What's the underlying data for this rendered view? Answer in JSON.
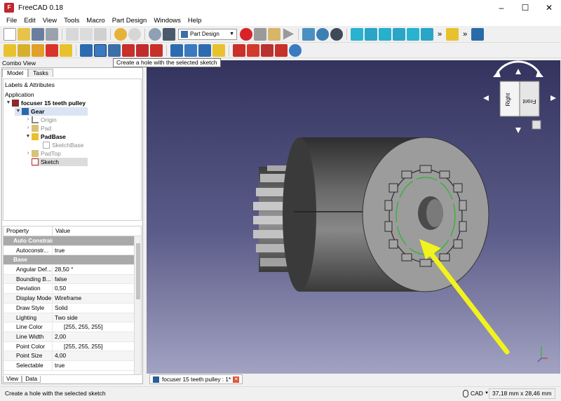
{
  "window": {
    "title": "FreeCAD 0.18",
    "minimize": "–",
    "maximize": "☐",
    "close": "✕"
  },
  "menu": [
    "File",
    "Edit",
    "View",
    "Tools",
    "Macro",
    "Part Design",
    "Windows",
    "Help"
  ],
  "toolbar": {
    "workbench": "Part Design",
    "overflow": "»"
  },
  "tooltip": "Create a hole with the selected sketch",
  "combo": {
    "title": "Combo View",
    "tabs": [
      "Model",
      "Tasks"
    ],
    "bottom_tabs": [
      "View",
      "Data"
    ]
  },
  "tree": {
    "section": "Labels & Attributes",
    "root": "Application",
    "items": [
      {
        "label": "focuser 15 teeth pulley"
      },
      {
        "label": "Gear"
      },
      {
        "label": "Origin"
      },
      {
        "label": "Pad"
      },
      {
        "label": "PadBase"
      },
      {
        "label": "SketchBase"
      },
      {
        "label": "PadTop"
      },
      {
        "label": "Sketch"
      }
    ]
  },
  "properties": {
    "headers": [
      "Property",
      "Value"
    ],
    "groups": [
      "Auto Constraints",
      "Base"
    ],
    "rows": [
      {
        "key": "Autoconstr...",
        "value": "true"
      },
      {
        "key": "Angular Def...",
        "value": "28,50 °"
      },
      {
        "key": "Bounding B...",
        "value": "false"
      },
      {
        "key": "Deviation",
        "value": "0,50"
      },
      {
        "key": "Display Mode",
        "value": "Wireframe"
      },
      {
        "key": "Draw Style",
        "value": "Solid"
      },
      {
        "key": "Lighting",
        "value": "Two side"
      },
      {
        "key": "Line Color",
        "value": "[255, 255, 255]"
      },
      {
        "key": "Line Width",
        "value": "2,00"
      },
      {
        "key": "Point Color",
        "value": "[255, 255, 255]"
      },
      {
        "key": "Point Size",
        "value": "4,00"
      },
      {
        "key": "Selectable",
        "value": "true"
      }
    ]
  },
  "navcube": {
    "face_front": "Right",
    "face_side": "Front"
  },
  "document_tab": {
    "label": "focuser 15 teeth pulley : 1*"
  },
  "status": {
    "message": "Create a hole with the selected sketch",
    "nav_style": "CAD",
    "dimensions": "37,18 mm x 28,46 mm"
  },
  "colors": {
    "viewport_top": "#33335e",
    "viewport_bottom": "#a2a2c2",
    "arrow": "#f2f21e",
    "sketch": "#2fb52f",
    "selection": "#dbe4f3"
  }
}
